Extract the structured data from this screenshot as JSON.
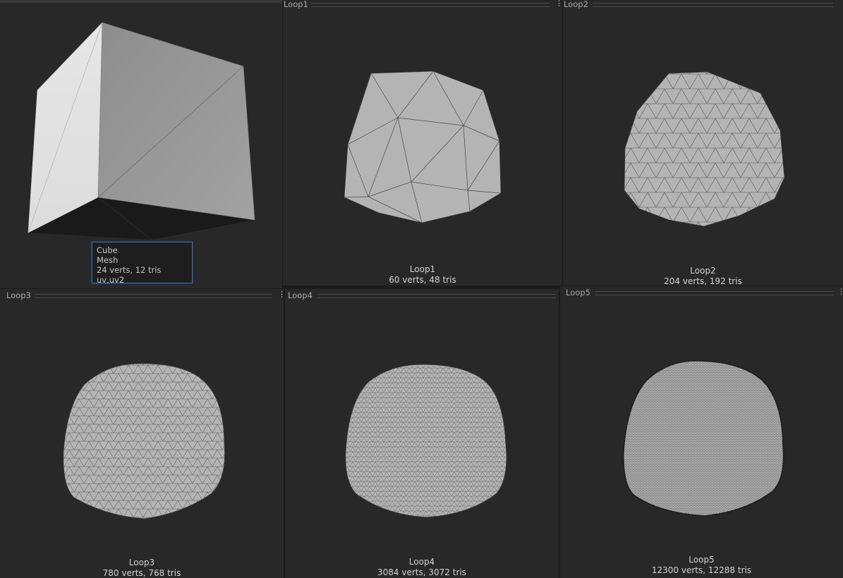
{
  "cube_preview": {
    "tooltip": {
      "name": "Cube",
      "type": "Mesh",
      "stats": "24 verts, 12 tris",
      "channels": "uv,uv2"
    }
  },
  "panels": [
    {
      "tab": "Loop1",
      "verts_tris": "60 verts, 48 tris"
    },
    {
      "tab": "Loop2",
      "verts_tris": "204 verts, 192 tris"
    },
    {
      "tab": "Loop3",
      "verts_tris": "780 verts, 768 tris"
    },
    {
      "tab": "Loop4",
      "verts_tris": "3084 verts, 3072 tris"
    },
    {
      "tab": "Loop5",
      "verts_tris": "12300 verts, 12288 tris"
    }
  ],
  "menu_icon": "kebab-menu-icon",
  "colors": {
    "panel_bg": "#282828",
    "mesh_fill": "#b4b4b4",
    "wire": "#4a4a4a",
    "tooltip_border": "#3a6aa0"
  }
}
